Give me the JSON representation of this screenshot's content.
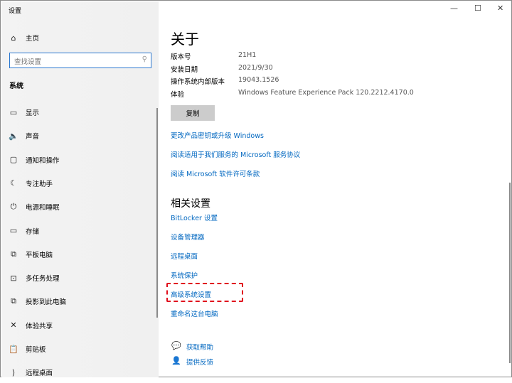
{
  "window": {
    "title": "设置",
    "minimize_icon": "minimize-icon",
    "maximize_icon": "maximize-icon",
    "close_icon": "close-icon"
  },
  "sidebar": {
    "home": "主页",
    "search_placeholder": "查找设置",
    "section": "系统",
    "items": [
      {
        "label": "显示",
        "icon": "monitor-icon"
      },
      {
        "label": "声音",
        "icon": "speaker-icon"
      },
      {
        "label": "通知和操作",
        "icon": "notification-icon"
      },
      {
        "label": "专注助手",
        "icon": "moon-icon"
      },
      {
        "label": "电源和睡眠",
        "icon": "power-icon"
      },
      {
        "label": "存储",
        "icon": "storage-icon"
      },
      {
        "label": "平板电脑",
        "icon": "tablet-icon"
      },
      {
        "label": "多任务处理",
        "icon": "multitask-icon"
      },
      {
        "label": "投影到此电脑",
        "icon": "project-icon"
      },
      {
        "label": "体验共享",
        "icon": "share-icon"
      },
      {
        "label": "剪贴板",
        "icon": "clipboard-icon"
      },
      {
        "label": "远程桌面",
        "icon": "remote-icon"
      }
    ]
  },
  "main": {
    "title": "关于",
    "specs": [
      {
        "label": "版本号",
        "value": "21H1"
      },
      {
        "label": "安装日期",
        "value": "2021/9/30"
      },
      {
        "label": "操作系统内部版本",
        "value": "19043.1526"
      },
      {
        "label": "体验",
        "value": "Windows Feature Experience Pack 120.2212.4170.0"
      }
    ],
    "copy_label": "复制",
    "links": [
      "更改产品密钥或升级 Windows",
      "阅读适用于我们服务的 Microsoft 服务协议",
      "阅读 Microsoft 软件许可条款"
    ],
    "related_title": "相关设置",
    "related_links": [
      "BitLocker 设置",
      "设备管理器",
      "远程桌面",
      "系统保护",
      "高级系统设置",
      "重命名这台电脑"
    ],
    "help": "获取帮助",
    "feedback": "提供反馈"
  }
}
